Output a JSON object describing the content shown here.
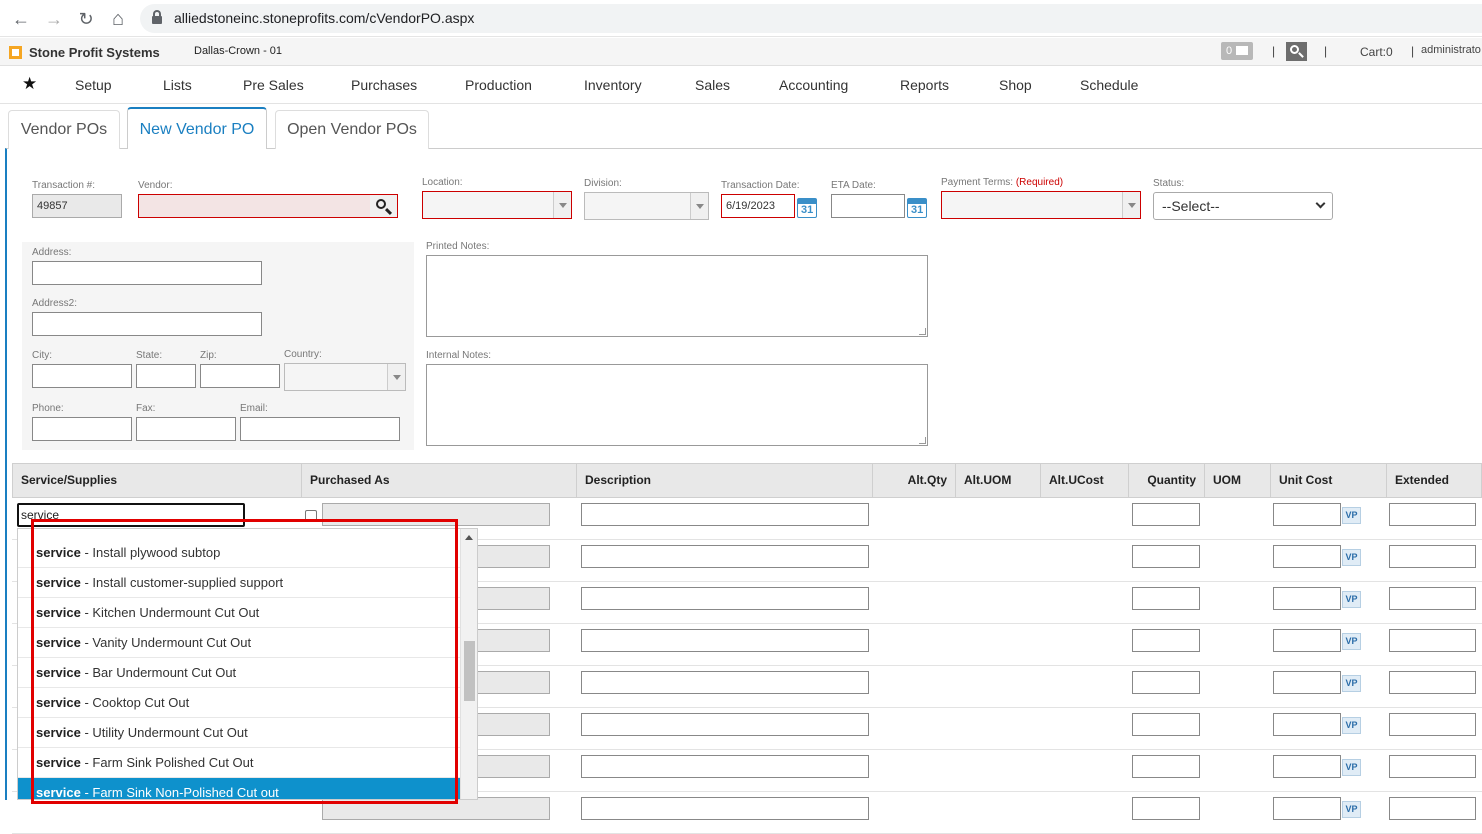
{
  "browser": {
    "url": "alliedstoneinc.stoneprofits.com/cVendorPO.aspx",
    "back": "←",
    "forward": "→",
    "reload": "↻",
    "home": "⌂"
  },
  "app": {
    "brand": "Stone Profit Systems",
    "location": "Dallas-Crown - 01",
    "messages": "0",
    "cart": "Cart:0",
    "user": "administrato",
    "separator": "|"
  },
  "menu": {
    "items": [
      "Setup",
      "Lists",
      "Pre Sales",
      "Purchases",
      "Production",
      "Inventory",
      "Sales",
      "Accounting",
      "Reports",
      "Shop",
      "Schedule"
    ]
  },
  "tabs": [
    "Vendor POs",
    "New Vendor PO",
    "Open Vendor POs"
  ],
  "form": {
    "transaction_label": "Transaction #:",
    "transaction_value": "49857",
    "vendor_label": "Vendor:",
    "location_label": "Location:",
    "division_label": "Division:",
    "txn_date_label": "Transaction Date:",
    "txn_date_value": "6/19/2023",
    "eta_label": "ETA Date:",
    "payment_label": "Payment Terms:",
    "payment_required": "(Required)",
    "status_label": "Status:",
    "status_value": "--Select--",
    "address_label": "Address:",
    "address2_label": "Address2:",
    "city_label": "City:",
    "state_label": "State:",
    "zip_label": "Zip:",
    "country_label": "Country:",
    "phone_label": "Phone:",
    "fax_label": "Fax:",
    "email_label": "Email:",
    "printed_notes_label": "Printed Notes:",
    "internal_notes_label": "Internal Notes:",
    "calendar_day": "31"
  },
  "grid": {
    "columns": [
      "Service/Supplies",
      "Purchased As",
      "Description",
      "Alt.Qty",
      "Alt.UOM",
      "Alt.UCost",
      "Quantity",
      "UOM",
      "Unit Cost",
      "Extended"
    ],
    "search_value": "service",
    "vp_label": "VP"
  },
  "autocomplete": {
    "prefix": "service",
    "items": [
      " - Install plywood subtop",
      " - Install customer-supplied support",
      " - Kitchen Undermount Cut Out",
      " - Vanity Undermount Cut Out",
      " - Bar Undermount Cut Out",
      " - Cooktop Cut Out",
      " - Utility Undermount Cut Out",
      " - Farm Sink Polished Cut Out",
      " - Farm Sink Non-Polished Cut out"
    ],
    "selected_index": 8
  },
  "colors": {
    "accent": "#1a7fc1",
    "highlight": "#0e91cc",
    "error": "#e10000",
    "logo": "#f5a623"
  }
}
